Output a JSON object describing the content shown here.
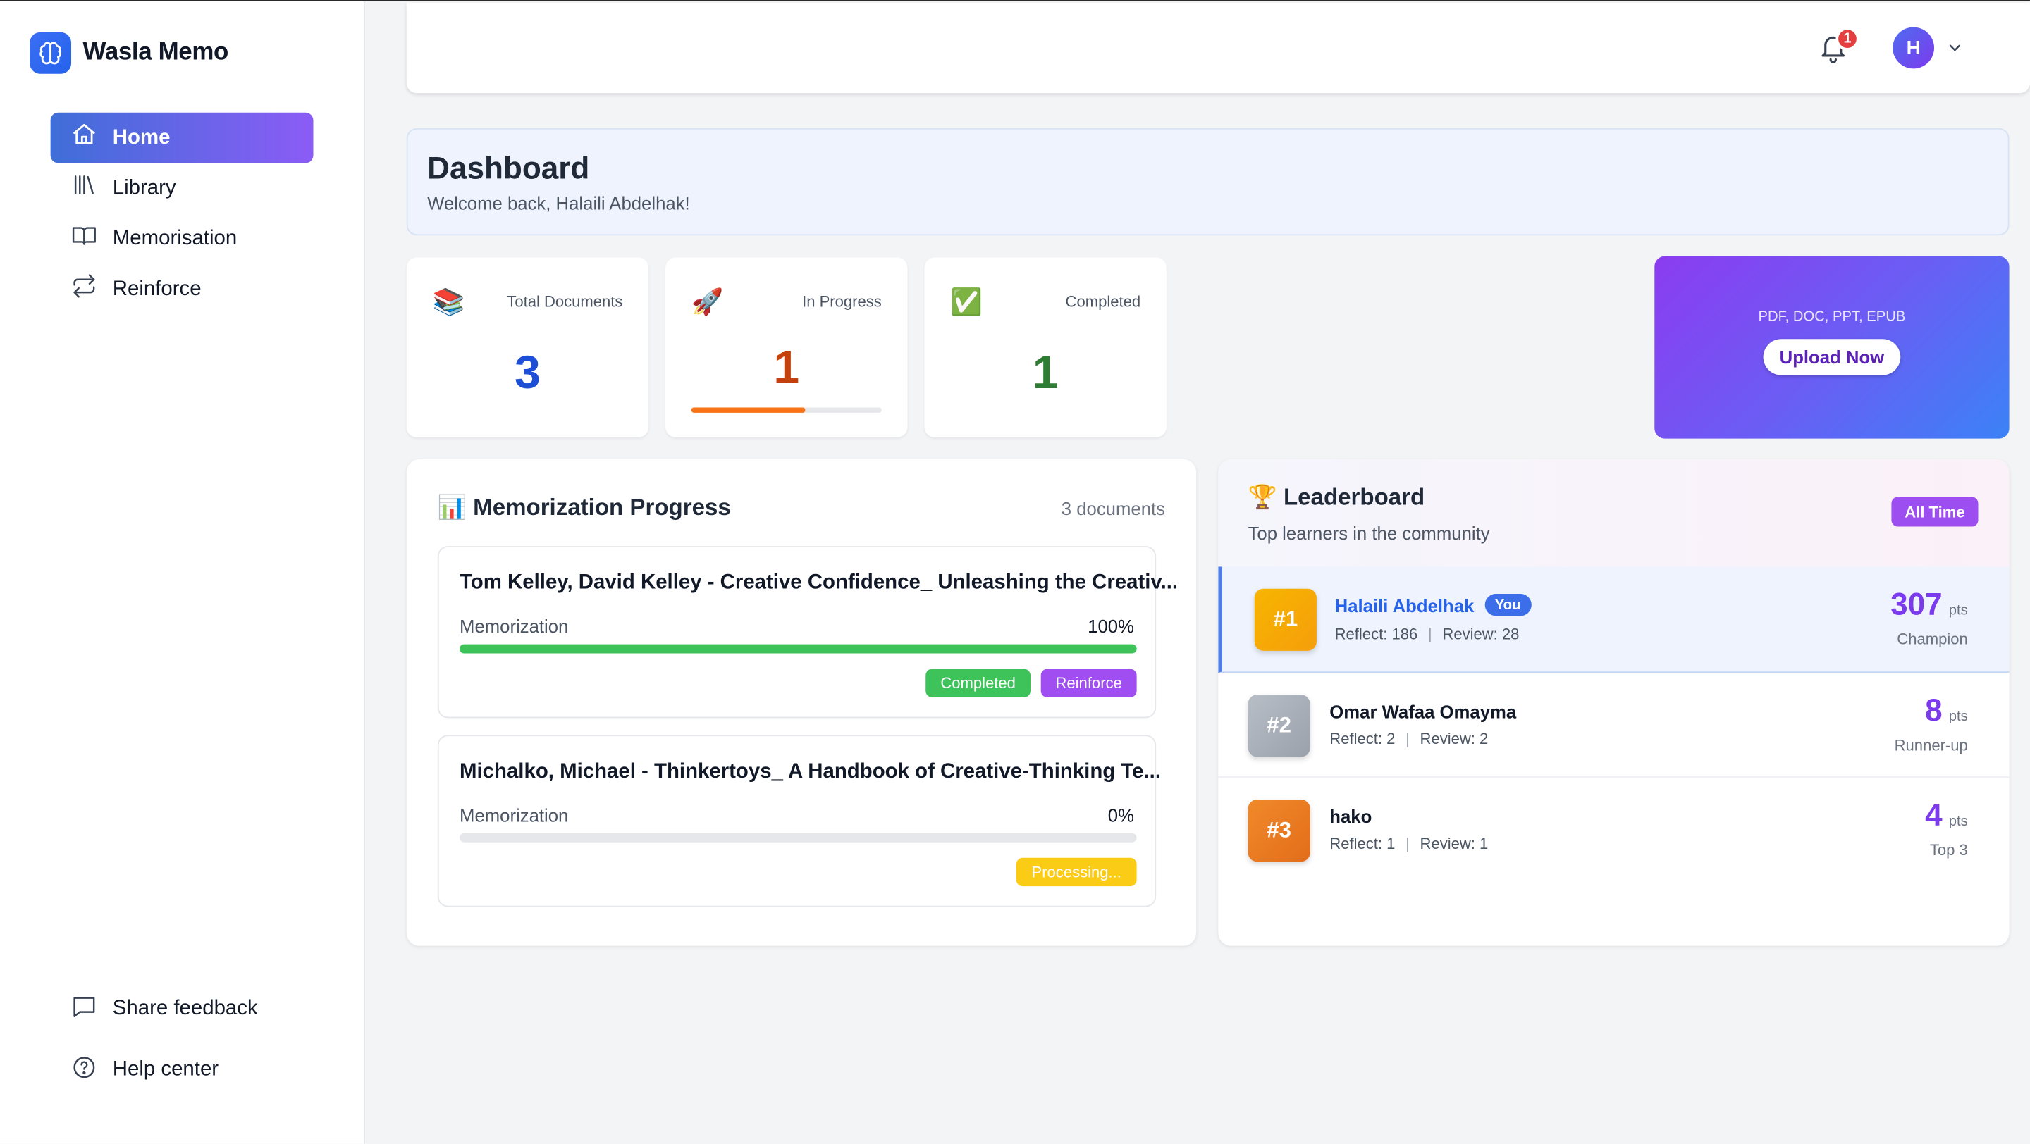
{
  "app": {
    "name": "Wasla Memo"
  },
  "sidebar": {
    "items": [
      {
        "label": "Home",
        "icon": "home-icon",
        "active": true
      },
      {
        "label": "Library",
        "icon": "library-icon"
      },
      {
        "label": "Memorisation",
        "icon": "book-icon"
      },
      {
        "label": "Reinforce",
        "icon": "repeat-icon"
      }
    ],
    "bottom": [
      {
        "label": "Share feedback",
        "icon": "message-icon"
      },
      {
        "label": "Help center",
        "icon": "help-icon"
      }
    ]
  },
  "header": {
    "notifications": "1",
    "avatar_initial": "H"
  },
  "dashboard": {
    "title": "Dashboard",
    "welcome": "Welcome back, Halaili Abdelhak!"
  },
  "stats": {
    "total": {
      "label": "Total Documents",
      "value": "3",
      "emoji": "📚",
      "color": "#1d4ed8"
    },
    "in_progress": {
      "label": "In Progress",
      "value": "1",
      "emoji": "🚀",
      "color": "#c2410c",
      "progress": 0.6
    },
    "completed": {
      "label": "Completed",
      "value": "1",
      "emoji": "✅",
      "color": "#2e7d32"
    }
  },
  "upload": {
    "formats": "PDF, DOC, PPT, EPUB",
    "button": "Upload Now"
  },
  "memorization": {
    "title": "Memorization Progress",
    "emoji": "📊",
    "count": "3 documents",
    "docs": [
      {
        "title": "Tom Kelley, David Kelley - Creative Confidence_ Unleashing the Creativ...",
        "label": "Memorization",
        "percent": "100%",
        "progress": 1.0,
        "tags": [
          "Completed",
          "Reinforce"
        ]
      },
      {
        "title": "Michalko, Michael - Thinkertoys_ A Handbook of Creative-Thinking Te...",
        "label": "Memorization",
        "percent": "0%",
        "progress": 0.0,
        "tags": [
          "Processing..."
        ]
      }
    ]
  },
  "leaderboard": {
    "title": "Leaderboard",
    "emoji": "🏆",
    "subtitle": "Top learners in the community",
    "filter": "All Time",
    "rows": [
      {
        "rank": "#1",
        "name": "Halaili Abdelhak",
        "you": "You",
        "reflect": "Reflect: 186",
        "review": "Review: 28",
        "points": "307",
        "unit": "pts",
        "label": "Champion"
      },
      {
        "rank": "#2",
        "name": "Omar Wafaa Omayma",
        "reflect": "Reflect: 2",
        "review": "Review: 2",
        "points": "8",
        "unit": "pts",
        "label": "Runner-up"
      },
      {
        "rank": "#3",
        "name": "hako",
        "reflect": "Reflect: 1",
        "review": "Review: 1",
        "points": "4",
        "unit": "pts",
        "label": "Top 3"
      }
    ]
  },
  "colors": {
    "accent": "#8b5cf6",
    "primary": "#2563eb",
    "success": "#3ec35a",
    "warning": "#facc15",
    "gold": "#f5a50b",
    "silver": "#a9afb8",
    "bronze": "#ea7a22"
  }
}
